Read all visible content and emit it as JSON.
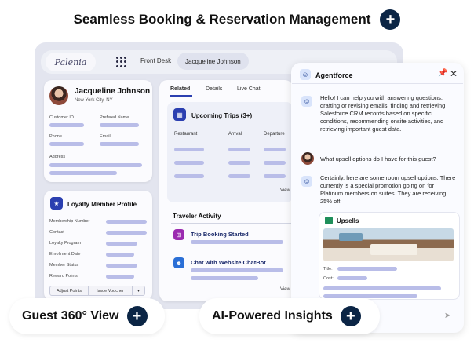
{
  "headline": {
    "title": "Seamless Booking & Reservation Management",
    "plus_icon": "plus-icon"
  },
  "app": {
    "logo": "Palenia",
    "tabs": [
      {
        "label": "Front Desk"
      },
      {
        "label": "Jacqueline Johnson"
      }
    ]
  },
  "profile": {
    "name": "Jacqueline Johnson",
    "location": "New York City, NY",
    "fields": {
      "customer_id": "Customer ID",
      "preferred_name": "Prefered Name",
      "phone": "Phone",
      "email": "Email",
      "address": "Address"
    }
  },
  "loyalty": {
    "title": "Loyalty Member Profile",
    "fields": [
      "Membership Number",
      "Contact",
      "Loyalty Program",
      "Enrollment Date",
      "Member Status",
      "Reward Points"
    ],
    "buttons": {
      "adjust": "Adjust Points",
      "issue": "Issue Voucher",
      "more": "▾"
    }
  },
  "related": {
    "tabs": [
      "Related",
      "Details",
      "Live Chat"
    ],
    "upcoming": {
      "title": "Upcoming Trips (3+)",
      "columns": [
        "Restaurant",
        "Arrival",
        "Departure"
      ],
      "view": "View"
    },
    "activity": {
      "title": "Traveler Activity",
      "items": [
        "Trip Booking Started",
        "Chat with Website ChatBot"
      ],
      "view": "View"
    }
  },
  "agentforce": {
    "title": "Agentforce",
    "messages": [
      "Hello! I can help you with answering questions, drafting or revising emails, finding and retrieving Salesforce CRM records based on specific conditions, recommending onsite activities, and retrieving important guest data.",
      "What upsell options do I have for this guest?",
      "Certainly, here are some room upsell options. There currently is a special promotion going on for Platinum members on suites. They are receiving 25% off."
    ],
    "upsells": {
      "title": "Upsells",
      "title_label": "Title:",
      "cost_label": "Cost:"
    }
  },
  "pills": {
    "guest": "Guest 360° View",
    "ai": "AI-Powered Insights"
  },
  "colors": {
    "accent": "#0b2545",
    "bar": "#b9bde8",
    "brand_blue": "#2b3fb0"
  }
}
